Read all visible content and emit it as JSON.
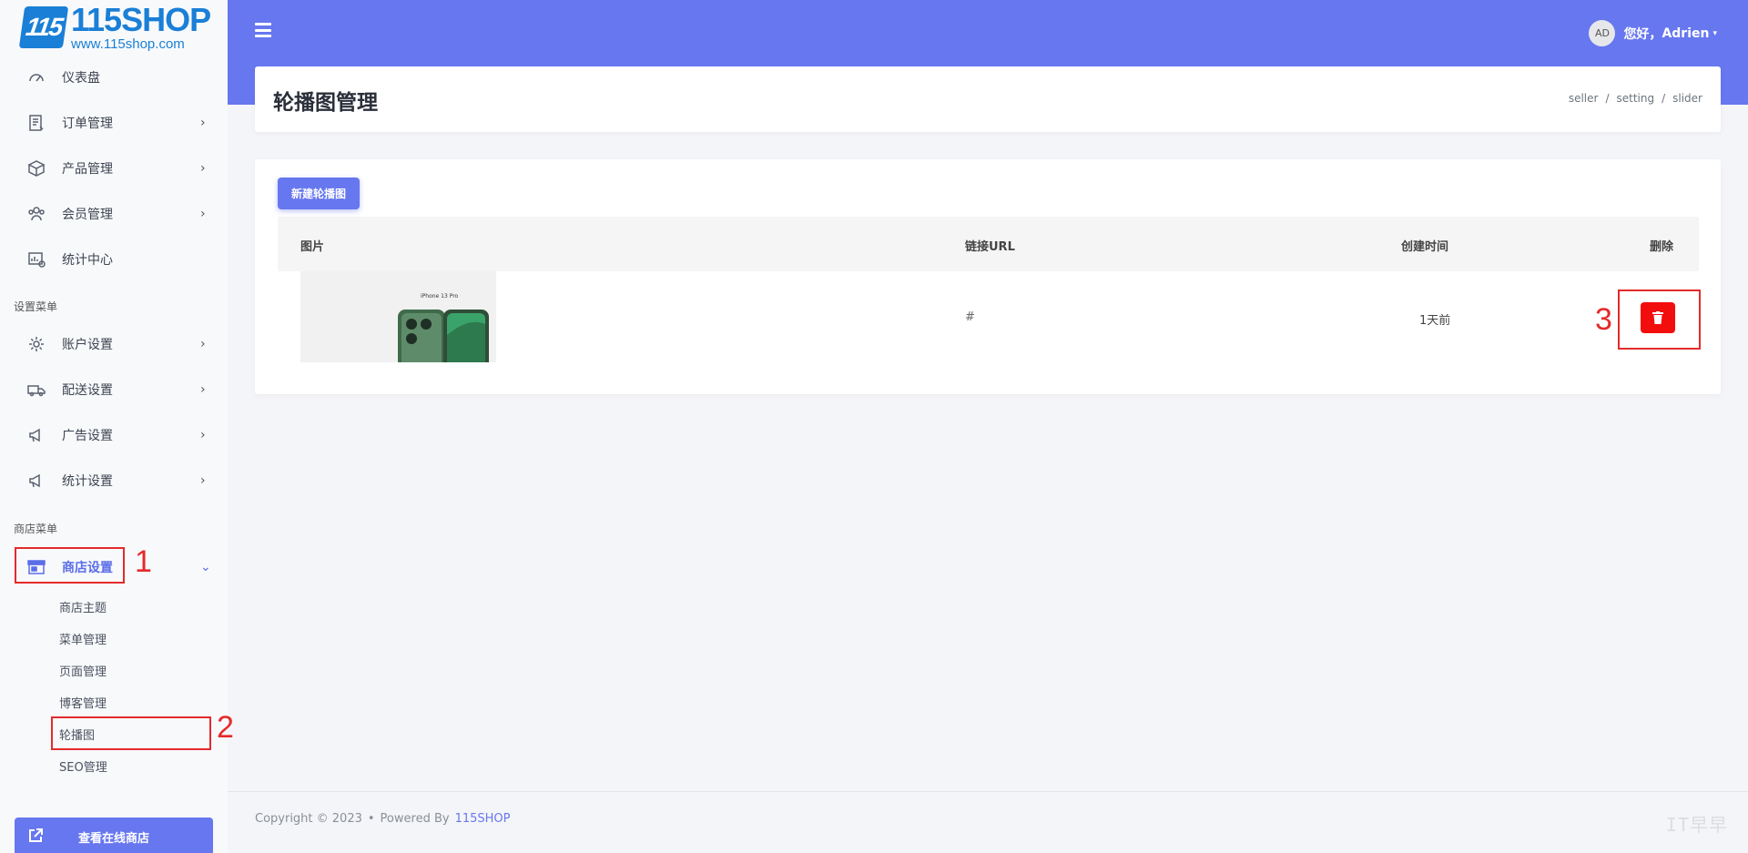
{
  "logo": {
    "mark": "115",
    "name": "115SHOP",
    "url": "www.115shop.com"
  },
  "sidebar": {
    "main_items": [
      {
        "label": "仪表盘",
        "icon": "speedometer-icon"
      },
      {
        "label": "订单管理",
        "icon": "order-list-icon",
        "chevron": "›"
      },
      {
        "label": "产品管理",
        "icon": "product-box-icon",
        "chevron": "›"
      },
      {
        "label": "会员管理",
        "icon": "users-icon",
        "chevron": "›"
      },
      {
        "label": "统计中心",
        "icon": "stats-icon"
      }
    ],
    "settings_section": "设置菜单",
    "settings_items": [
      {
        "label": "账户设置",
        "icon": "gear-icon",
        "chevron": "›"
      },
      {
        "label": "配送设置",
        "icon": "truck-icon",
        "chevron": "›"
      },
      {
        "label": "广告设置",
        "icon": "megaphone-icon",
        "chevron": "›"
      },
      {
        "label": "统计设置",
        "icon": "megaphone-icon",
        "chevron": "›"
      }
    ],
    "shop_section": "商店菜单",
    "shop_settings": {
      "label": "商店设置",
      "icon": "store-icon",
      "chevron": "⌄"
    },
    "shop_sub_items": [
      "商店主题",
      "菜单管理",
      "页面管理",
      "博客管理",
      "轮播图",
      "SEO管理"
    ],
    "view_shop_button": "查看在线商店"
  },
  "header": {
    "avatar_initials": "AD",
    "greeting": "您好，",
    "username": "Adrien",
    "caret": "▾"
  },
  "page": {
    "title": "轮播图管理",
    "breadcrumb": [
      "seller",
      "/",
      "setting",
      "/",
      "slider"
    ]
  },
  "content": {
    "new_button": "新建轮播图",
    "columns": {
      "image": "图片",
      "url": "链接URL",
      "created": "创建时间",
      "delete": "删除"
    },
    "rows": [
      {
        "thumb_caption": "iPhone 13 Pro",
        "url": "#",
        "created": "1天前"
      }
    ]
  },
  "footer": {
    "copyright": "Copyright © 2023",
    "dot": "•",
    "powered": "Powered By",
    "link": "115SHOP",
    "watermark": "IT早早"
  },
  "annotations": [
    "1",
    "2",
    "3"
  ],
  "colors": {
    "accent": "#6777ef",
    "danger": "#f30e0e",
    "annotation": "#e42b2b",
    "logo": "#1a7fd6"
  }
}
